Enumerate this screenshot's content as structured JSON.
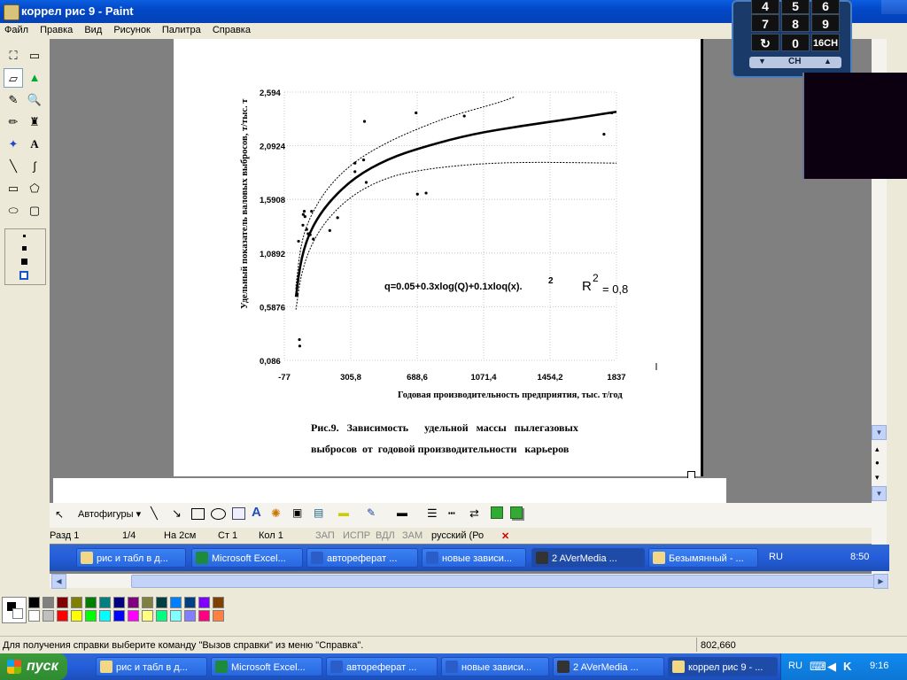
{
  "window": {
    "title": "коррел рис 9 - Paint"
  },
  "menu": [
    "Файл",
    "Правка",
    "Вид",
    "Рисунок",
    "Палитра",
    "Справка"
  ],
  "tools": {
    "free_select": "⛶",
    "rect_select": "▭",
    "eraser": "▱",
    "fill": "▲",
    "picker": "✎",
    "zoom": "🔍",
    "pencil": "✏",
    "brush": "♜",
    "airbrush": "✦",
    "text": "A",
    "line": "╲",
    "curve": "∫",
    "rectangle": "▭",
    "polygon": "⬠",
    "ellipse": "⬭",
    "rounded_rect": "▢"
  },
  "chart_data": {
    "type": "scatter",
    "ylabel": "Удельный показатель валовых выбросов, т/тыс. т",
    "xlabel": "Годовая производительность предприятия, тыс. т/год",
    "xticks": [
      "-77",
      "305,8",
      "688,6",
      "1071,4",
      "1454,2",
      "1837"
    ],
    "yticks": [
      "2,594",
      "2,0924",
      "1,5908",
      "1,0892",
      "0,5876",
      "0,086"
    ],
    "xlim": [
      -77,
      1837
    ],
    "ylim": [
      0.086,
      2.594
    ],
    "formula": "q=0.05+0.3xlog(Q)+0.1xloq(x).",
    "formula_sup": "2",
    "r2_label": "R",
    "r2_sup": "2",
    "r2_value": "= 0,8",
    "points": [
      [
        -5,
        0.76
      ],
      [
        -3,
        0.7
      ],
      [
        5,
        1.2
      ],
      [
        10,
        0.28
      ],
      [
        12,
        0.22
      ],
      [
        30,
        1.35
      ],
      [
        32,
        1.45
      ],
      [
        38,
        1.48
      ],
      [
        42,
        1.43
      ],
      [
        52,
        1.31
      ],
      [
        60,
        1.27
      ],
      [
        72,
        1.26
      ],
      [
        80,
        1.48
      ],
      [
        90,
        1.22
      ],
      [
        185,
        1.3
      ],
      [
        230,
        1.42
      ],
      [
        330,
        1.85
      ],
      [
        330,
        1.93
      ],
      [
        380,
        1.96
      ],
      [
        385,
        2.32
      ],
      [
        395,
        1.75
      ],
      [
        682,
        2.4
      ],
      [
        690,
        1.64
      ],
      [
        740,
        1.65
      ],
      [
        960,
        2.37
      ],
      [
        1765,
        2.2
      ],
      [
        1810,
        2.4
      ]
    ],
    "trend": [
      [
        -10,
        0.68
      ],
      [
        20,
        1.05
      ],
      [
        80,
        1.33
      ],
      [
        180,
        1.57
      ],
      [
        330,
        1.8
      ],
      [
        520,
        1.97
      ],
      [
        720,
        2.08
      ],
      [
        1000,
        2.2
      ],
      [
        1300,
        2.28
      ],
      [
        1600,
        2.35
      ],
      [
        1837,
        2.41
      ]
    ],
    "upper": [
      [
        -10,
        0.78
      ],
      [
        20,
        1.2
      ],
      [
        80,
        1.46
      ],
      [
        180,
        1.72
      ],
      [
        330,
        1.95
      ],
      [
        520,
        2.13
      ],
      [
        720,
        2.27
      ],
      [
        900,
        2.38
      ],
      [
        1150,
        2.49
      ],
      [
        1250,
        2.55
      ]
    ],
    "lower": [
      [
        -10,
        0.56
      ],
      [
        20,
        0.9
      ],
      [
        80,
        1.18
      ],
      [
        180,
        1.43
      ],
      [
        330,
        1.65
      ],
      [
        520,
        1.8
      ],
      [
        720,
        1.87
      ],
      [
        1000,
        1.92
      ],
      [
        1300,
        1.94
      ],
      [
        1837,
        1.93
      ]
    ]
  },
  "caption": {
    "line1": "Рис.9.   Зависимость      удельной   массы   пылегазовых",
    "line2": "выбросов  от  годовой производительности   карьеров"
  },
  "word_toolbar": {
    "autoshapes": "Автофигуры ▾"
  },
  "word_status": {
    "section": "Разд  1",
    "page": "1/4",
    "at": "На  2см",
    "line": "Ст  1",
    "col": "Кол  1",
    "rec": "ЗАП",
    "trk": "ИСПР",
    "ext": "ВДЛ",
    "ovr": "ЗАМ",
    "lang": "русский (Ро"
  },
  "inner_taskbar": {
    "tasks": [
      "рис и табл в д...",
      "Microsoft Excel...",
      "автореферат ...",
      "новые зависи...",
      "2 AVerMedia ...",
      "Безымянный - ..."
    ],
    "lang": "RU",
    "time": "8:50"
  },
  "status_bar": {
    "help": "Для получения справки выберите команду \"Вызов справки\" из меню \"Справка\".",
    "coords": "802,660"
  },
  "taskbar": {
    "start": "пуск",
    "tasks": [
      "рис и табл в д...",
      "Microsoft Excel...",
      "автореферат ...",
      "новые зависи...",
      "2 AVerMedia ...",
      "коррел рис 9 - ..."
    ],
    "lang": "RU",
    "time": "9:16"
  },
  "remote": {
    "row0": [
      "4",
      "5",
      "6"
    ],
    "row1": [
      "7",
      "8",
      "9"
    ],
    "row2": [
      "↻",
      "0",
      "16CH"
    ],
    "ch": "CH"
  },
  "palette": {
    "colors_top": [
      "#000000",
      "#808080",
      "#800000",
      "#808000",
      "#008000",
      "#008080",
      "#000080",
      "#800080",
      "#808040",
      "#004040",
      "#0080ff",
      "#004080",
      "#8000ff",
      "#804000"
    ],
    "colors_bottom": [
      "#ffffff",
      "#c0c0c0",
      "#ff0000",
      "#ffff00",
      "#00ff00",
      "#00ffff",
      "#0000ff",
      "#ff00ff",
      "#ffff80",
      "#00ff80",
      "#80ffff",
      "#8080ff",
      "#ff0080",
      "#ff8040"
    ]
  }
}
